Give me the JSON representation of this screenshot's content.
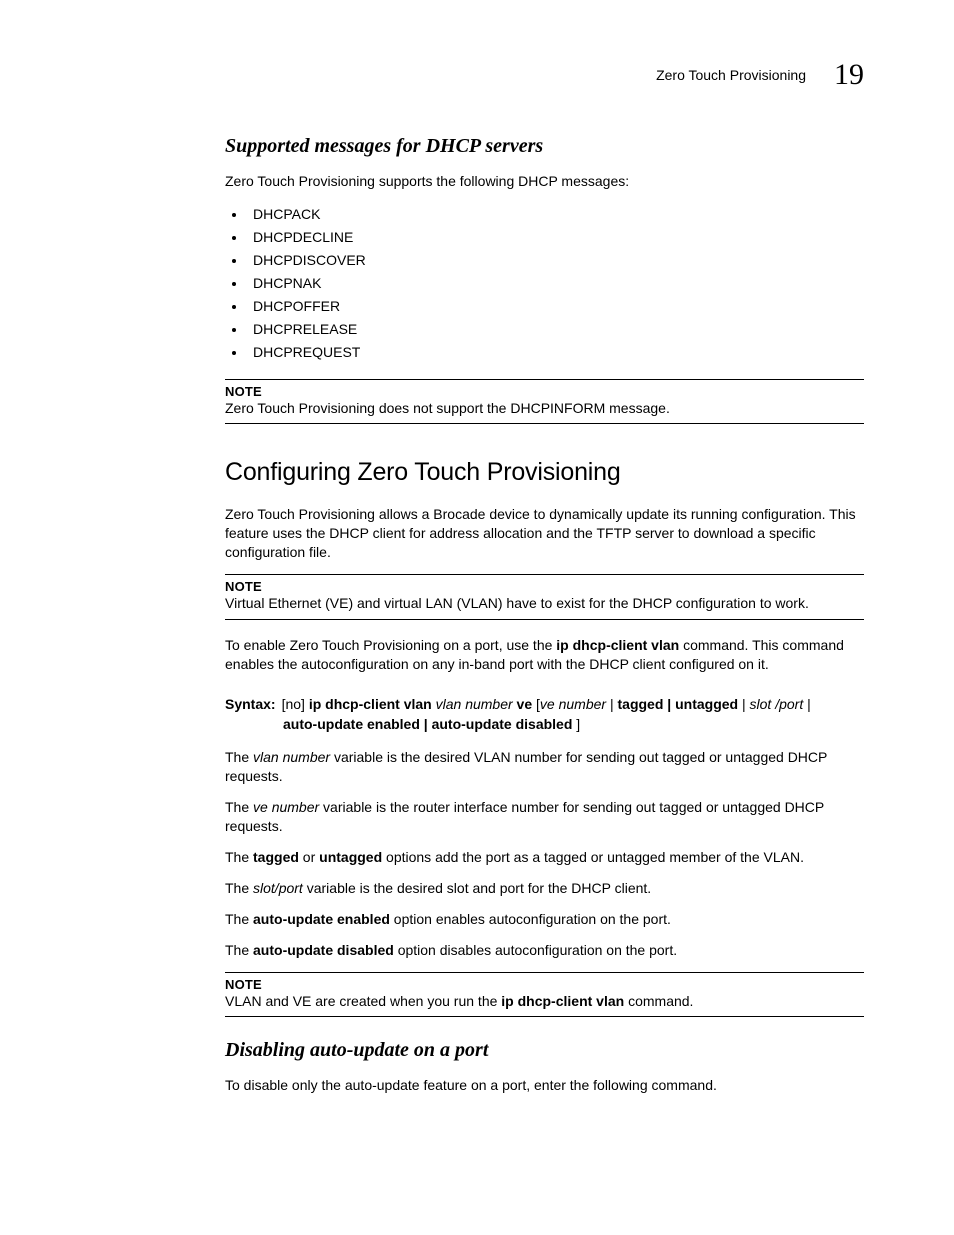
{
  "header": {
    "running_title": "Zero Touch Provisioning",
    "chapter_number": "19"
  },
  "section1": {
    "heading": "Supported messages for DHCP servers",
    "intro": "Zero Touch Provisioning supports the following DHCP messages:",
    "items": [
      "DHCPACK",
      "DHCPDECLINE",
      "DHCPDISCOVER",
      "DHCPNAK",
      "DHCPOFFER",
      "DHCPRELEASE",
      "DHCPREQUEST"
    ],
    "note_label": "NOTE",
    "note_text": "Zero Touch Provisioning does not support the DHCPINFORM message."
  },
  "section2": {
    "heading": "Configuring Zero Touch Provisioning",
    "para1": "Zero Touch Provisioning allows a Brocade device to dynamically update its running configuration. This feature uses the DHCP client for address allocation and the TFTP server to download a specific configuration file.",
    "note1_label": "NOTE",
    "note1_text": "Virtual Ethernet (VE) and virtual LAN (VLAN) have to exist for the DHCP configuration to work.",
    "para2_pre": "To enable Zero Touch Provisioning on a port, use the ",
    "para2_cmd": "ip dhcp-client vlan",
    "para2_post": " command. This command enables the autoconfiguration on any in-band port with the DHCP client configured on it.",
    "syntax": {
      "label": "Syntax:",
      "p_no": "[no] ",
      "p_cmd1": "ip dhcp-client vlan ",
      "p_var1": "vlan number",
      "p_ve": " ve ",
      "p_br_open": "[",
      "p_var2": "ve number",
      "p_pipe": " | ",
      "p_tag": "tagged | untagged",
      "p_pipe2": " | ",
      "p_var3": "slot /port",
      "p_pipe3": " |",
      "line2_b": "auto-update enabled | auto-update disabled",
      "line2_end": " ]"
    },
    "desc1_pre": "The ",
    "desc1_var": "vlan number",
    "desc1_post": " variable is the desired VLAN number for sending out tagged or untagged DHCP requests.",
    "desc2_pre": "The ",
    "desc2_var": "ve number",
    "desc2_post": " variable is the router interface number for sending out tagged or untagged DHCP requests.",
    "desc3_pre": "The ",
    "desc3_b1": "tagged",
    "desc3_mid": " or ",
    "desc3_b2": "untagged",
    "desc3_post": " options add the port as a tagged or untagged member of the VLAN.",
    "desc4_pre": "The ",
    "desc4_var": "slot/port",
    "desc4_post": " variable is the desired slot and port for the DHCP client.",
    "desc5_pre": "The ",
    "desc5_b": "auto-update enabled",
    "desc5_post": " option enables autoconfiguration on the port.",
    "desc6_pre": "The ",
    "desc6_b": "auto-update disabled",
    "desc6_post": " option disables autoconfiguration on the port.",
    "note2_label": "NOTE",
    "note2_pre": "VLAN and VE are created when you run the ",
    "note2_cmd": "ip dhcp-client vlan",
    "note2_post": " command."
  },
  "section3": {
    "heading": "Disabling auto-update on a port",
    "para": "To disable only the auto-update feature on a port, enter the following command."
  }
}
